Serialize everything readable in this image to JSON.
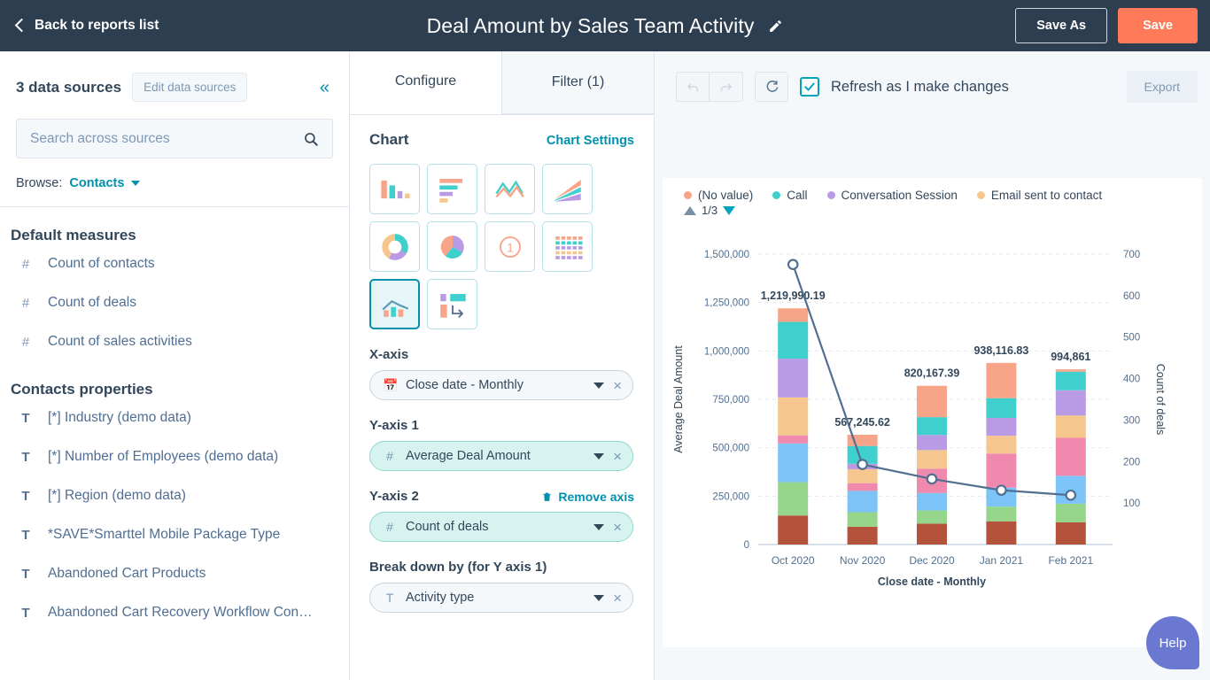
{
  "topbar": {
    "back_label": "Back to reports list",
    "title": "Deal Amount by Sales Team Activity",
    "edit_icon": "pencil-icon",
    "save_as_label": "Save As",
    "save_label": "Save",
    "bg_color": "#2d3e50",
    "save_color": "#ff7a59"
  },
  "sidebar": {
    "data_sources_label": "3 data sources",
    "edit_sources_label": "Edit data sources",
    "collapse_icon": "chevron-double-left-icon",
    "search": {
      "value": "",
      "placeholder": "Search across sources",
      "icon": "search-icon"
    },
    "browse_label": "Browse:",
    "browse_value": "Contacts",
    "measures_title": "Default measures",
    "measures": [
      {
        "icon": "#",
        "label": "Count of contacts"
      },
      {
        "icon": "#",
        "label": "Count of deals"
      },
      {
        "icon": "#",
        "label": "Count of sales activities"
      }
    ],
    "properties_title": "Contacts properties",
    "properties": [
      {
        "icon": "T",
        "label": "[*] Industry (demo data)"
      },
      {
        "icon": "T",
        "label": "[*] Number of Employees (demo data)"
      },
      {
        "icon": "T",
        "label": "[*] Region (demo data)"
      },
      {
        "icon": "T",
        "label": "*SAVE*Smarttel Mobile Package Type"
      },
      {
        "icon": "T",
        "label": "Abandoned Cart Products"
      },
      {
        "icon": "T",
        "label": "Abandoned Cart Recovery Workflow Con…"
      }
    ]
  },
  "config": {
    "tabs": [
      {
        "label": "Configure",
        "active": true
      },
      {
        "label": "Filter (1)",
        "active": false
      }
    ],
    "chart_heading": "Chart",
    "chart_settings_link": "Chart Settings",
    "chart_types": [
      {
        "name": "vertical-bar-chart-icon",
        "selected": false
      },
      {
        "name": "horizontal-bar-chart-icon",
        "selected": false
      },
      {
        "name": "line-chart-icon",
        "selected": false
      },
      {
        "name": "area-chart-icon",
        "selected": false
      },
      {
        "name": "donut-chart-icon",
        "selected": false
      },
      {
        "name": "pie-chart-icon",
        "selected": false
      },
      {
        "name": "single-value-chart-icon",
        "selected": false
      },
      {
        "name": "table-chart-icon",
        "selected": false
      },
      {
        "name": "combo-chart-icon",
        "selected": true
      },
      {
        "name": "pivot-table-icon",
        "selected": false
      }
    ],
    "x_axis_label": "X-axis",
    "x_axis_value": "Close date - Monthly",
    "x_axis_icon": "calendar-icon",
    "y_axis_1_label": "Y-axis 1",
    "y_axis_1_value": "Average Deal Amount",
    "y_axis_1_icon": "#",
    "y_axis_2_label": "Y-axis 2",
    "y_axis_2_value": "Count of deals",
    "y_axis_2_icon": "#",
    "remove_axis_label": "Remove axis",
    "remove_axis_icon": "trash-icon",
    "breakdown_label": "Break down by (for Y axis 1)",
    "breakdown_value": "Activity type",
    "breakdown_icon": "T"
  },
  "toolbar": {
    "undo_icon": "undo-icon",
    "redo_icon": "redo-icon",
    "refresh_icon": "refresh-icon",
    "refresh_checkbox_label": "Refresh as I make changes",
    "refresh_checked": true,
    "export_label": "Export"
  },
  "help": {
    "label": "Help",
    "color": "#6a78d1"
  },
  "chart_data": {
    "type": "bar",
    "subtype": "stacked-bar-with-line-combo",
    "title": "",
    "xlabel": "Close date - Monthly",
    "ylabel": "Average Deal Amount",
    "y2label": "Count of deals",
    "categories": [
      "Oct 2020",
      "Nov 2020",
      "Dec 2020",
      "Jan 2021",
      "Feb 2021"
    ],
    "ylim": [
      0,
      1500000
    ],
    "yticks": [
      "0",
      "250,000",
      "500,000",
      "750,000",
      "1,000,000",
      "1,250,000",
      "1,500,000"
    ],
    "ytick_values": [
      0,
      250000,
      500000,
      750000,
      1000000,
      1250000,
      1500000
    ],
    "y2lim": [
      0,
      700
    ],
    "y2ticks": [
      "100",
      "200",
      "300",
      "400",
      "500",
      "600",
      "700"
    ],
    "y2tick_values": [
      100,
      200,
      300,
      400,
      500,
      600,
      700
    ],
    "grid": true,
    "legend_position": "top",
    "legend": [
      {
        "label": "(No value)",
        "color": "#f8a488"
      },
      {
        "label": "Call",
        "color": "#3fd0cd"
      },
      {
        "label": "Conversation Session",
        "color": "#b99ae4"
      },
      {
        "label": "Email sent to contact",
        "color": "#f5c78e"
      }
    ],
    "legend_pager": "1/3",
    "bar_totals": [
      "1,219,990.19",
      "567,245.62",
      "820,167.39",
      "938,116.83",
      "994,861"
    ],
    "bar_total_values": [
      1219990.19,
      567245.62,
      820167.39,
      938116.83,
      994861
    ],
    "stack_colors": [
      "#b5523c",
      "#96d68a",
      "#7cc4f8",
      "#ef8aae",
      "#f5c78e",
      "#b99ae4",
      "#3fd0cd",
      "#f8a488"
    ],
    "stack_series": [
      {
        "name": "seg-1",
        "color": "#b5523c",
        "values": [
          150000,
          92000,
          108000,
          120000,
          115000
        ]
      },
      {
        "name": "seg-2",
        "color": "#96d68a",
        "values": [
          172000,
          75000,
          68000,
          76000,
          96000
        ]
      },
      {
        "name": "seg-3",
        "color": "#7cc4f8",
        "values": [
          200000,
          110000,
          90000,
          98000,
          144000
        ]
      },
      {
        "name": "seg-4",
        "color": "#ef8aae",
        "values": [
          42000,
          40000,
          126000,
          176000,
          196000
        ]
      },
      {
        "name": "seg-5",
        "color": "#f5c78e",
        "values": [
          196000,
          72000,
          96000,
          92000,
          116000
        ]
      },
      {
        "name": "seg-6",
        "color": "#b99ae4",
        "values": [
          200000,
          28000,
          78000,
          92000,
          130000
        ]
      },
      {
        "name": "seg-7",
        "color": "#3fd0cd",
        "values": [
          190000,
          92000,
          92000,
          102000,
          96000
        ]
      },
      {
        "name": "seg-8",
        "color": "#f8a488",
        "values": [
          70000,
          58000,
          162000,
          182000,
          12000
        ]
      }
    ],
    "line_series": {
      "name": "Count of deals",
      "color": "#516f90",
      "values": [
        675,
        193,
        158,
        131,
        119
      ]
    }
  }
}
